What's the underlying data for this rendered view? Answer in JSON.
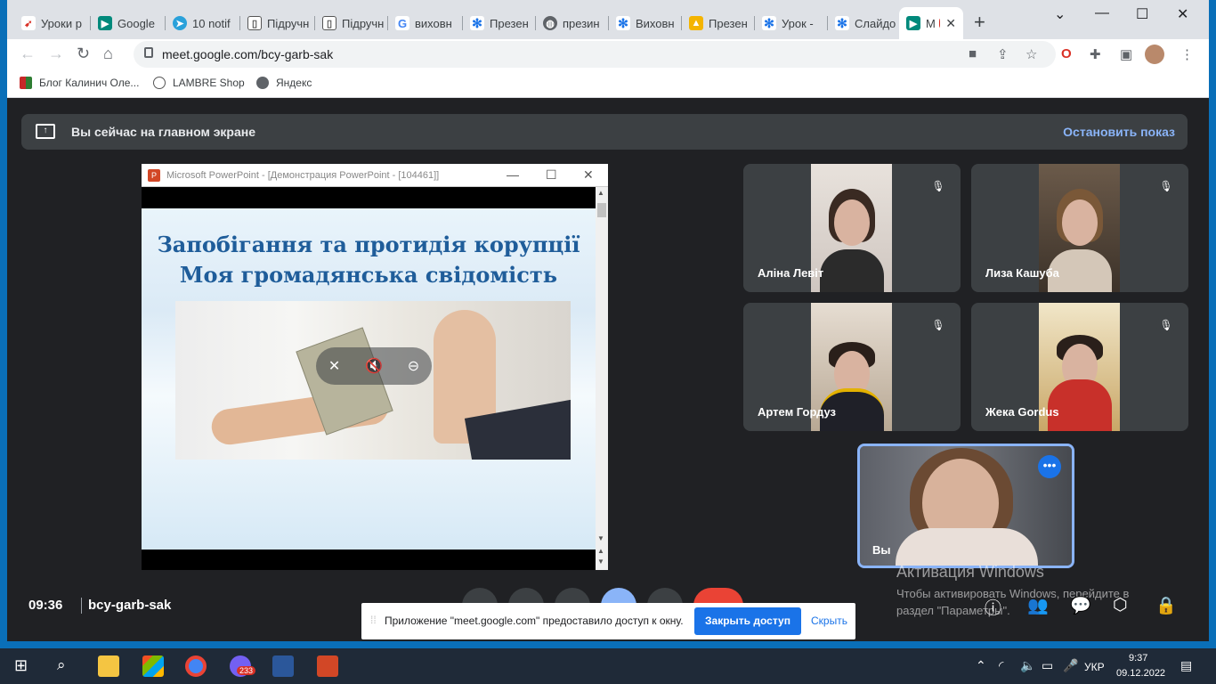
{
  "browser": {
    "tabs": [
      {
        "label": "Уроки р",
        "icon": "rocket-icon"
      },
      {
        "label": "Google",
        "icon": "google-meet-icon"
      },
      {
        "label": "10 notif",
        "icon": "telegram-icon"
      },
      {
        "label": "Підручн",
        "icon": "book-icon"
      },
      {
        "label": "Підручн",
        "icon": "book-icon"
      },
      {
        "label": "виховн",
        "icon": "google-icon"
      },
      {
        "label": "Презен",
        "icon": "snowflake-icon"
      },
      {
        "label": "презин",
        "icon": "globe-icon"
      },
      {
        "label": "Виховн",
        "icon": "snowflake-icon"
      },
      {
        "label": "Презен",
        "icon": "slides-icon"
      },
      {
        "label": "Урок -",
        "icon": "snowflake-icon"
      },
      {
        "label": "Слайдо",
        "icon": "snowflake-icon"
      },
      {
        "label": "M",
        "icon": "google-meet-icon",
        "active": true
      }
    ],
    "url": "meet.google.com/bcy-garb-sak",
    "bookmarks": [
      {
        "label": "Блог Калинич Оле..."
      },
      {
        "label": "LAMBRE Shop"
      },
      {
        "label": "Яндекс"
      }
    ]
  },
  "meet": {
    "banner_text": "Вы сейчас на главном экране",
    "stop_label": "Остановить показ",
    "time": "09:36",
    "meeting_code": "bcy-garb-sak",
    "participants": [
      {
        "name": "Аліна Левіт"
      },
      {
        "name": "Лиза Кашуба"
      },
      {
        "name": "Артем Гордуз"
      },
      {
        "name": "Жека Gordus"
      }
    ],
    "self_name": "Вы"
  },
  "powerpoint": {
    "window_title": "Microsoft PowerPoint - [Демонстрация PowerPoint - [104461]]",
    "slide_title_1": "Запобігання та протидія корупції",
    "slide_title_2": "Моя громадянська свідомість"
  },
  "share_notice": {
    "text": "Приложение \"meet.google.com\" предоставило доступ к окну.",
    "stop_label": "Закрыть доступ",
    "hide_label": "Скрыть"
  },
  "activation": {
    "title": "Активация Windows",
    "line1": "Чтобы активировать Windows, перейдите в",
    "line2": "раздел \"Параметры\"."
  },
  "taskbar": {
    "badge": "233",
    "lang": "УКР",
    "time": "9:37",
    "date": "09.12.2022"
  }
}
